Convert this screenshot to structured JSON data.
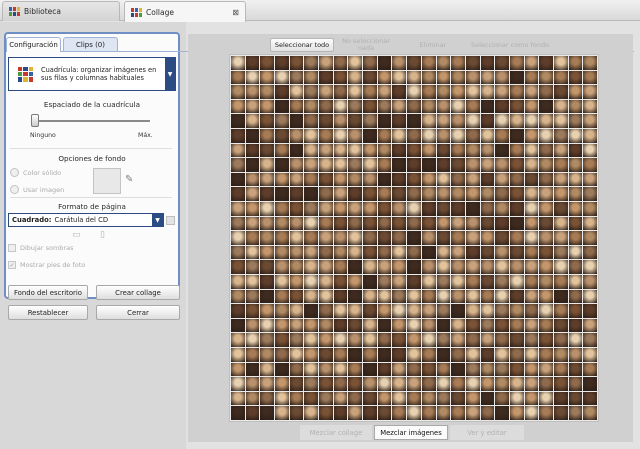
{
  "tabs": {
    "library": "Biblioteca",
    "collage": "Collage",
    "close": "⊠"
  },
  "panel": {
    "tab_config": "Configuración",
    "tab_clips": "Clips (0)",
    "layout_desc": "Cuadrícula: organizar imágenes en sus filas y columnas habituales",
    "grid_spacing_title": "Espaciado de la cuadrícula",
    "slider_min": "Ninguno",
    "slider_max": "Máx.",
    "slider_value": 0,
    "bg_title": "Opciones de fondo",
    "bg_solid": "Color sólido",
    "bg_image": "Usar imagen",
    "page_format_title": "Formato de página",
    "format_bold": "Cuadrado:",
    "format_rest": "Carátula del CD",
    "draw_shadows": "Dibujar sombras",
    "show_footer": "Mostrar pies de foto",
    "show_footer_checked": true
  },
  "buttons": {
    "desktop_bg": "Fondo del escritorio",
    "create": "Crear collage",
    "reset": "Restablecer",
    "close": "Cerrar"
  },
  "toolbar": {
    "select_all": "Seleccionar todo",
    "select_none": "No seleccionar nada",
    "delete": "Eliminar",
    "set_bg": "Seleccionar como fondo"
  },
  "bottom": {
    "mix_collage": "Mezclar collage",
    "mix_images": "Mezclar imágenes",
    "view_edit": "Ver y editar"
  },
  "colors": {
    "accent": "#2c4a83",
    "panel_border": "#6f8fc4"
  },
  "icons": {
    "library": "grid-icon",
    "collage": "collage-icon",
    "eyedropper": "eyedropper-icon"
  }
}
